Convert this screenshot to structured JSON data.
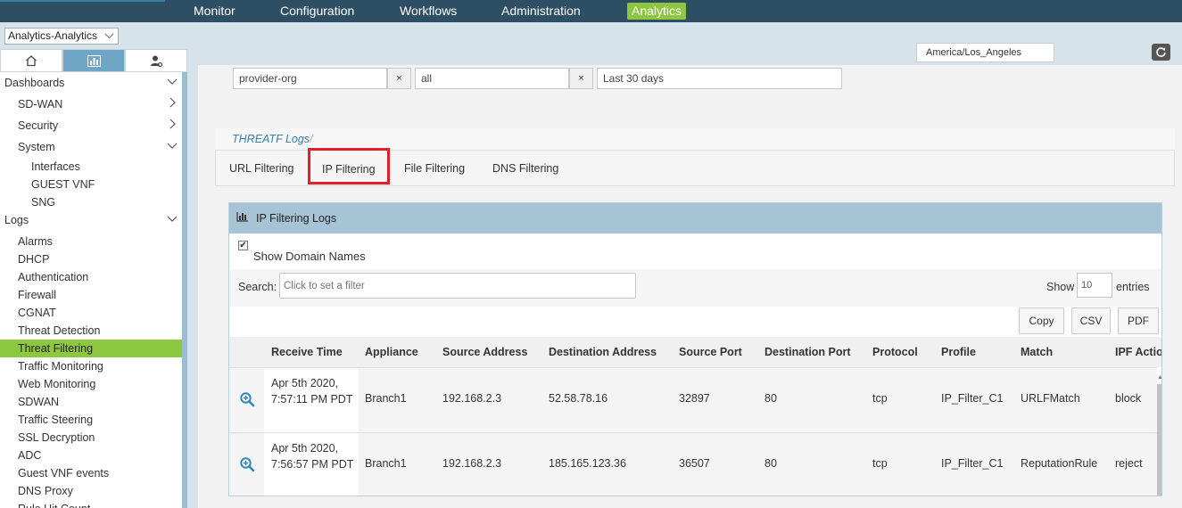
{
  "topnav": {
    "items": [
      "Monitor",
      "Configuration",
      "Workflows",
      "Administration",
      "Analytics"
    ],
    "active": "Analytics"
  },
  "tenant_select": {
    "value": "Analytics-Analytics"
  },
  "side_tabs": [
    "home-icon",
    "chart-icon",
    "user-settings-icon"
  ],
  "sidebar": {
    "dashboards": "Dashboards",
    "sdwan": "SD-WAN",
    "security": "Security",
    "system": "System",
    "interfaces": "Interfaces",
    "guest_vnf": "GUEST VNF",
    "sng": "SNG",
    "logs": "Logs",
    "log_items": [
      "Alarms",
      "DHCP",
      "Authentication",
      "Firewall",
      "CGNAT",
      "Threat Detection",
      "Threat Filtering",
      "Traffic Monitoring",
      "Web Monitoring",
      "SDWAN",
      "Traffic Steering",
      "SSL Decryption",
      "ADC",
      "Guest VNF events",
      "DNS Proxy",
      "Rule Hit Count"
    ],
    "selected": "Threat Filtering"
  },
  "timezone": "America/Los_Angeles",
  "filters": {
    "org": "provider-org",
    "appliance": "all",
    "range": "Last 30 days",
    "clear_symbol": "×"
  },
  "breadcrumb": {
    "label": "THREATF Logs",
    "separator": "/"
  },
  "tabs": [
    "URL Filtering",
    "IP Filtering",
    "File Filtering",
    "DNS Filtering"
  ],
  "active_tab": "IP Filtering",
  "panel": {
    "title": "IP Filtering Logs",
    "show_domain_names": "Show Domain Names",
    "checkbox_mark": "✔",
    "search_label": "Search:",
    "search_placeholder": "Click to set a filter",
    "show_label": "Show",
    "show_value": "10",
    "entries_label": "entries",
    "export": {
      "copy": "Copy",
      "csv": "CSV",
      "pdf": "PDF"
    }
  },
  "table": {
    "columns": [
      "Receive Time",
      "Appliance",
      "Source Address",
      "Destination Address",
      "Source Port",
      "Destination Port",
      "Protocol",
      "Profile",
      "Match",
      "IPF Action"
    ],
    "rows": [
      {
        "receive_time": "Apr 5th 2020, 7:57:11 PM PDT",
        "appliance": "Branch1",
        "source_address": "192.168.2.3",
        "destination_address": "52.58.78.16",
        "source_port": "32897",
        "destination_port": "80",
        "protocol": "tcp",
        "profile": "IP_Filter_C1",
        "match": "URLFMatch",
        "action": "block"
      },
      {
        "receive_time": "Apr 5th 2020, 7:56:57 PM PDT",
        "appliance": "Branch1",
        "source_address": "192.168.2.3",
        "destination_address": "185.165.123.36",
        "source_port": "36507",
        "destination_port": "80",
        "protocol": "tcp",
        "profile": "IP_Filter_C1",
        "match": "ReputationRule",
        "action": "reject"
      }
    ]
  }
}
